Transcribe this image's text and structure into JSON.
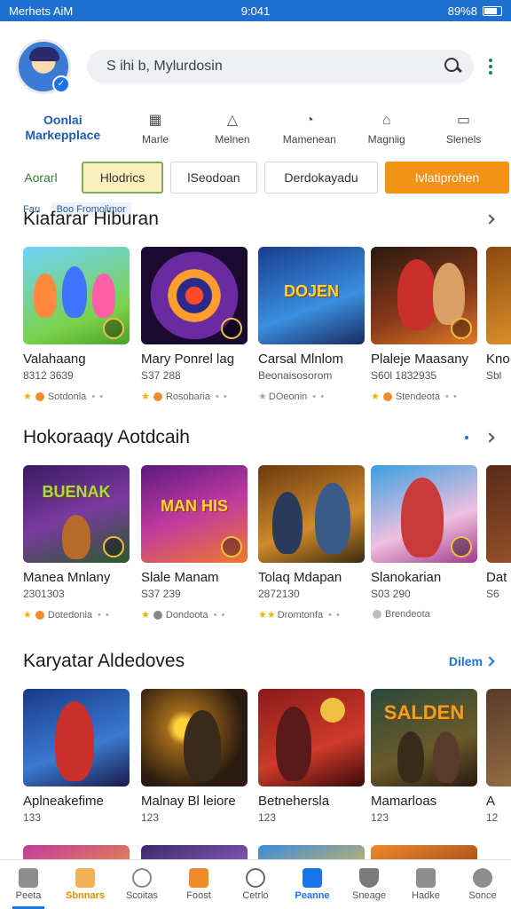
{
  "status_bar": {
    "left": "Merhets AiM",
    "center": "9:041",
    "right": "89%8"
  },
  "search": {
    "placeholder": "S ihi b, Mylurdosin"
  },
  "categories": [
    {
      "label": "Oonlai Markepplace",
      "icon": "brand"
    },
    {
      "label": "Marle",
      "icon": "grid-icon"
    },
    {
      "label": "Melnen",
      "icon": "triangle-icon"
    },
    {
      "label": "Mamenean",
      "icon": "controller-icon"
    },
    {
      "label": "Magniig",
      "icon": "home-icon"
    },
    {
      "label": "Slenels",
      "icon": "monitor-icon"
    }
  ],
  "chips": [
    "Aorarl",
    "Hlodrics",
    "lSeodoan",
    "Derdokayadu",
    "Ivlatiprohen"
  ],
  "filters": [
    "Farı",
    "Boo Fromolimor"
  ],
  "sections": [
    {
      "title": "Kiafarar Hiburan",
      "more": "",
      "cards": [
        {
          "name": "Valahaang",
          "sub": "8312 3639",
          "meta": "Sotdonla"
        },
        {
          "name": "Mary Ponrel lag",
          "sub": "S37 288",
          "meta": "Rosobaria"
        },
        {
          "name": "Carsal Mlnlom",
          "sub": "Beonaisosorom",
          "meta": "DOeonin"
        },
        {
          "name": "Plaleje Maasany",
          "sub": "S60l 1832935",
          "meta": "Stendeota"
        },
        {
          "name": "Kno",
          "sub": "Sbl",
          "meta": ""
        }
      ]
    },
    {
      "title": "Hokoraaqy Aotdcaih",
      "more": "",
      "cards": [
        {
          "name": "Manea Mnlany",
          "sub": "2301303",
          "meta": "Dotedonia"
        },
        {
          "name": "Slale Manam",
          "sub": "S37 239",
          "meta": "Dondoota"
        },
        {
          "name": "Tolaq Mdapan",
          "sub": "2872130",
          "meta": "Dromtonfa"
        },
        {
          "name": "Slanokarian",
          "sub": "S03 290",
          "meta": "Brendeota"
        },
        {
          "name": "Dat",
          "sub": "S6",
          "meta": ""
        }
      ]
    },
    {
      "title": "Karyatar Aldedoves",
      "more": "Dilem",
      "cards": [
        {
          "name": "Aplneakefime",
          "sub": "133",
          "meta": ""
        },
        {
          "name": "Malnay Bl leiore",
          "sub": "123",
          "meta": ""
        },
        {
          "name": "Betnehersla",
          "sub": "123",
          "meta": ""
        },
        {
          "name": "Mamarloas",
          "sub": "123",
          "meta": ""
        },
        {
          "name": "A",
          "sub": "12",
          "meta": ""
        }
      ]
    }
  ],
  "bottom_nav": [
    "Peeta",
    "Sbnnars",
    "Scoitas",
    "Foost",
    "Cetrlo",
    "Peanne",
    "Sneage",
    "Hadke",
    "Sonce"
  ],
  "colors": {
    "primary": "#1f6fd1",
    "accent": "#f39215",
    "selected_chip": "#fbefbd"
  }
}
